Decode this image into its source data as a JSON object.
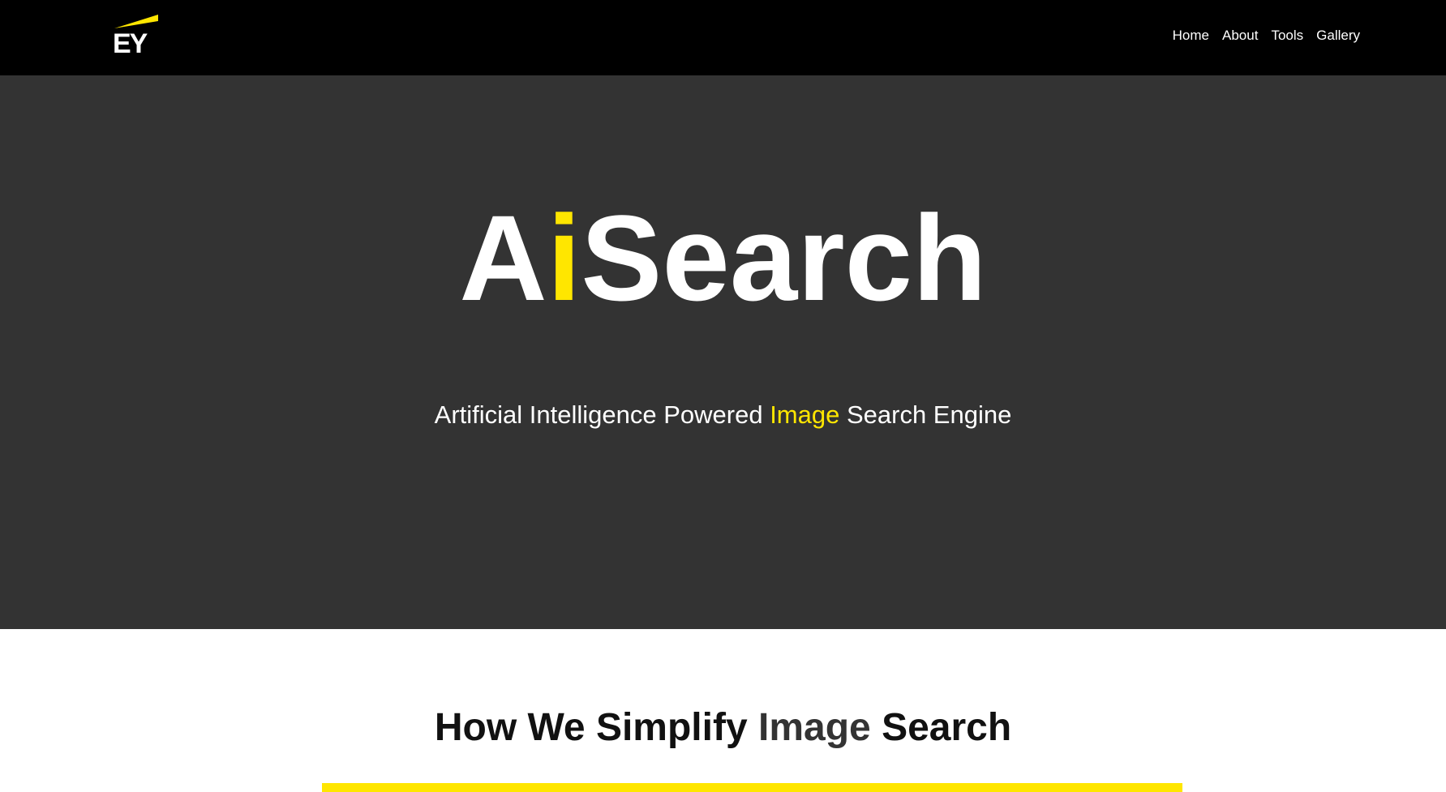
{
  "brand": {
    "logo_text": "EY",
    "accent_color": "#ffe600"
  },
  "nav": {
    "items": [
      {
        "label": "Home"
      },
      {
        "label": "About"
      },
      {
        "label": "Tools"
      },
      {
        "label": "Gallery"
      }
    ]
  },
  "hero": {
    "title_part1": "A",
    "title_accent": "i",
    "title_part2": "Search",
    "subtitle_part1": "Artificial Intelligence Powered ",
    "subtitle_accent": "Image",
    "subtitle_part2": " Search Engine",
    "background_color": "#333333"
  },
  "section": {
    "heading_part1": "How We Simplify ",
    "heading_muted": "Image",
    "heading_part2": " Search"
  }
}
